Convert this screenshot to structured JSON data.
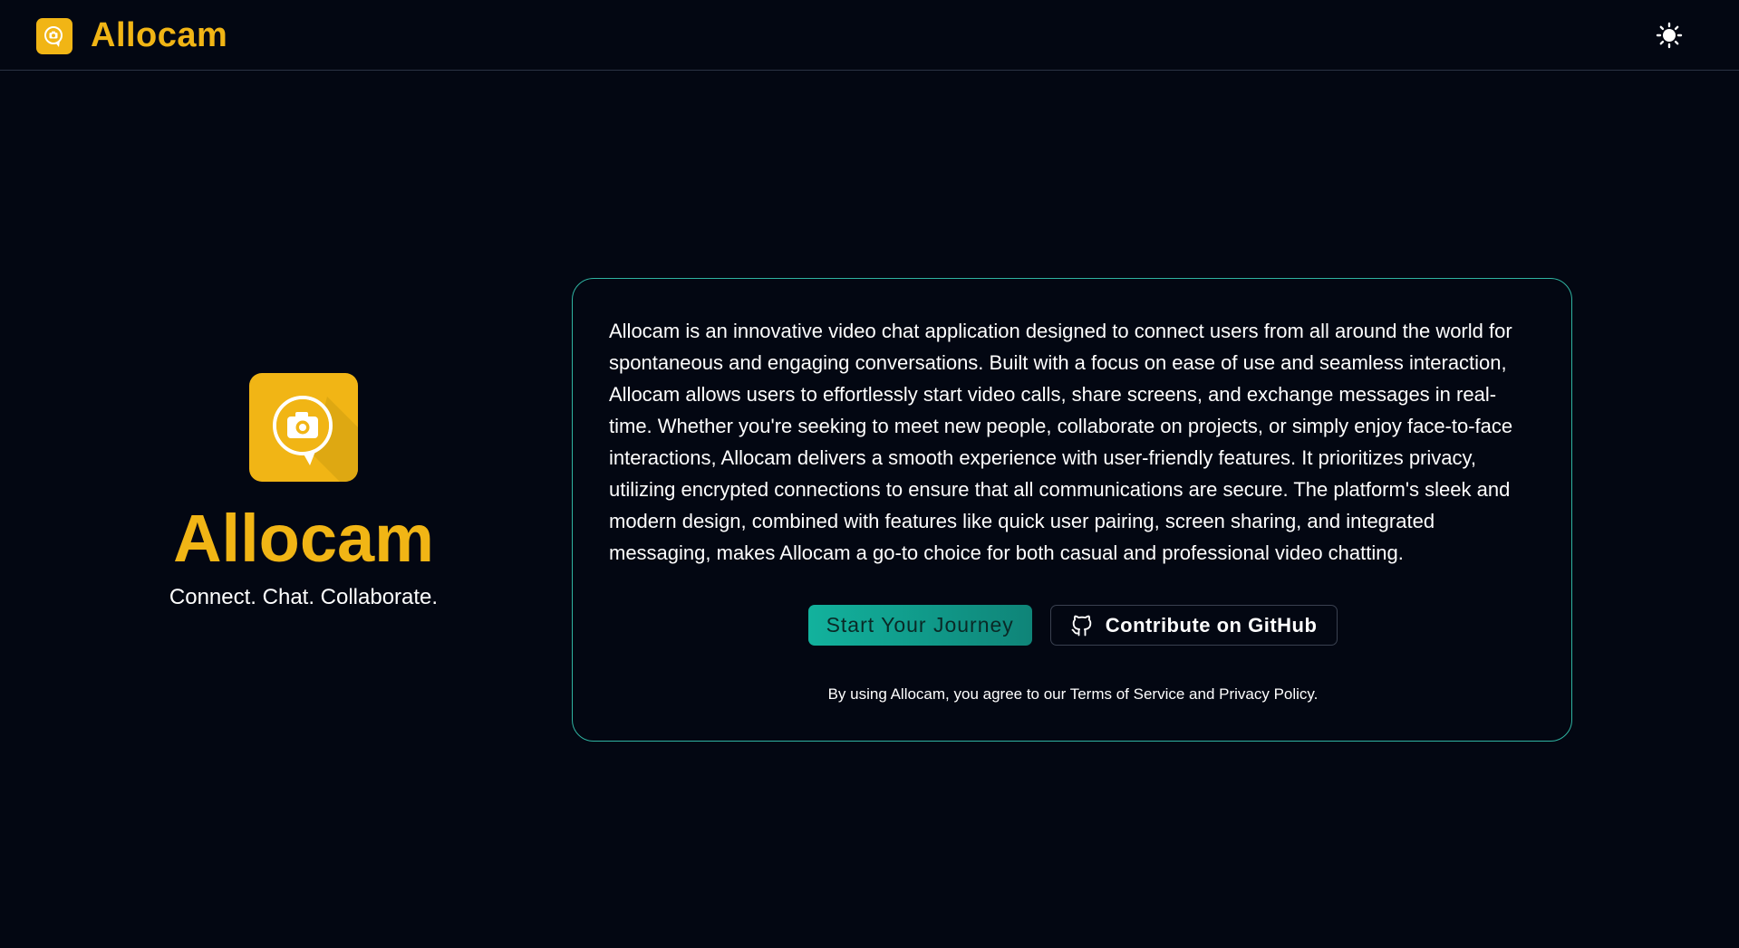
{
  "navbar": {
    "brand_title": "Allocam",
    "logo_icon": "camera-chat-icon",
    "theme_icon": "sun-icon"
  },
  "hero": {
    "logo_icon": "camera-chat-icon",
    "title": "Allocam",
    "tagline": "Connect. Chat. Collaborate."
  },
  "card": {
    "description": "Allocam is an innovative video chat application designed to connect users from all around the world for spontaneous and engaging conversations. Built with a focus on ease of use and seamless interaction, Allocam allows users to effortlessly start video calls, share screens, and exchange messages in real-time. Whether you're seeking to meet new people, collaborate on projects, or simply enjoy face-to-face interactions, Allocam delivers a smooth experience with user-friendly features. It prioritizes privacy, utilizing encrypted connections to ensure that all communications are secure. The platform's sleek and modern design, combined with features like quick user pairing, screen sharing, and integrated messaging, makes Allocam a go-to choice for both casual and professional video chatting.",
    "primary_button": "Start Your Journey",
    "secondary_button": "Contribute on GitHub",
    "secondary_icon": "github-icon",
    "legal_prefix": "By using Allocam, you agree to our ",
    "terms_link": "Terms of Service",
    "legal_and": " and ",
    "privacy_link": "Privacy Policy",
    "legal_suffix": "."
  },
  "colors": {
    "background": "#030712",
    "brand_yellow": "#f1b515",
    "accent_teal": "#12b29d",
    "card_border": "#2fb3a1"
  }
}
